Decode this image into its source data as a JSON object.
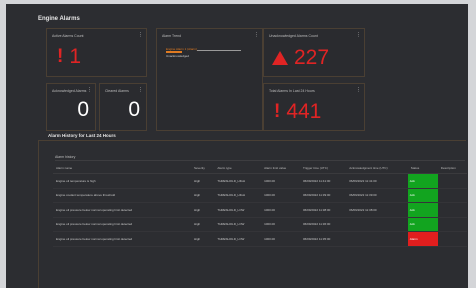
{
  "page": {
    "title": "Engine Alarms"
  },
  "tiles": {
    "active_alarms": {
      "title": "Active Alarms Count",
      "value": "1",
      "color": "#e02424"
    },
    "alarm_trend": {
      "title": "Alarm Trend",
      "legend_label": "Engine Alarm 1 (Alarm)",
      "legend_sub": "Unacknowledged"
    },
    "unacknowledged": {
      "title": "Unacknowledged Alarms Count",
      "value": "227",
      "color": "#e02424"
    },
    "acknowledged": {
      "title": "Acknowledged Alarms",
      "value": "0"
    },
    "cleared": {
      "title": "Cleared Alarms",
      "value": "0"
    },
    "total_alarms": {
      "title": "Total Alarms In Last 24 Hours",
      "value": "441",
      "color": "#e02424"
    }
  },
  "history": {
    "title": "Alarm History for Last 24 Hours",
    "subheading": "Alarm history",
    "columns": [
      "Alarm name",
      "Severity",
      "Alarm type",
      "Alarm limit value",
      "Trigger time (UTC)",
      "Acknowledgment time (UTC)",
      "Status",
      "Description"
    ],
    "rows": [
      {
        "name": "Engine oil temperature is high",
        "severity": "High",
        "type": "THRESHOLD_HIGH",
        "limit": "1000.00",
        "trigger": "06/09/2022 11:41:00",
        "ack": "06/09/2022 11:41:00",
        "status": "Ack",
        "status_color": "#12a41f"
      },
      {
        "name": "Engine coolant temperature above threshold",
        "severity": "High",
        "type": "THRESHOLD_HIGH",
        "limit": "1000.00",
        "trigger": "06/09/2022 11:39:00",
        "ack": "06/09/2022 11:39:00",
        "status": "Ack",
        "status_color": "#12a41f"
      },
      {
        "name": "Engine oil pressure below normal operating limit detected",
        "severity": "High",
        "type": "THRESHOLD_LOW",
        "limit": "1000.00",
        "trigger": "06/09/2022 11:38:00",
        "ack": "06/09/2022 11:38:00",
        "status": "Ack",
        "status_color": "#12a41f"
      },
      {
        "name": "Engine oil pressure below normal operating limit detected",
        "severity": "High",
        "type": "THRESHOLD_LOW",
        "limit": "1000.00",
        "trigger": "06/09/2022 11:36:00",
        "ack": "",
        "status": "Ack",
        "status_color": "#12a41f"
      },
      {
        "name": "Engine oil pressure below normal operating limit detected",
        "severity": "High",
        "type": "THRESHOLD_LOW",
        "limit": "1000.00",
        "trigger": "06/09/2022 11:35:00",
        "ack": "",
        "status": "Alarm",
        "status_color": "#e11e1e"
      }
    ]
  },
  "icons": {
    "tile_menu": "vertical-ellipsis-icon",
    "warning": "triangle-warning-icon",
    "exclamation": "exclamation-icon"
  }
}
